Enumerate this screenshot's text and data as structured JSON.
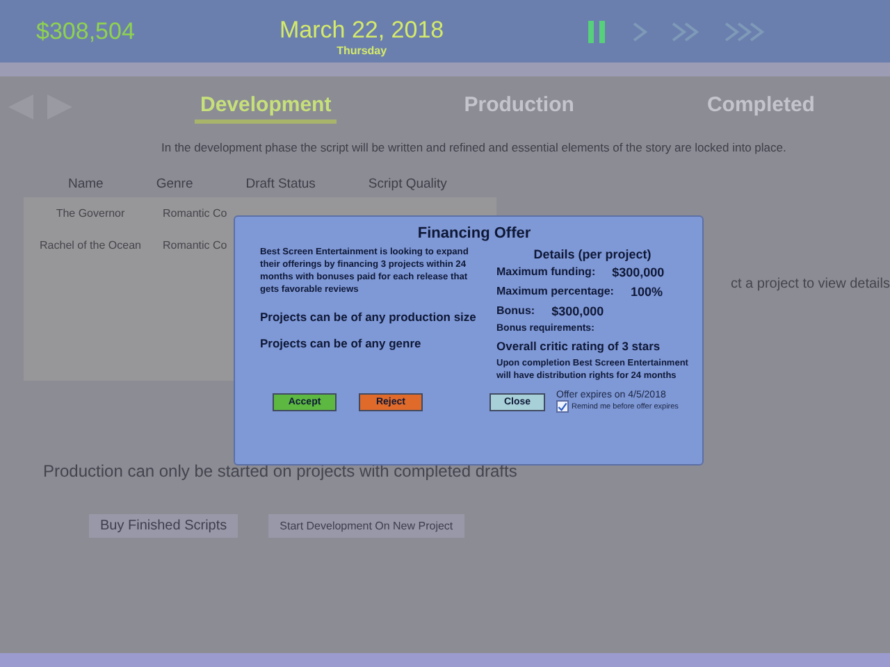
{
  "top_bar": {
    "money": "$308,504",
    "date": "March 22, 2018",
    "weekday": "Thursday",
    "speed_controls": [
      {
        "kind": "pause",
        "selected": true
      },
      {
        "kind": "play",
        "selected": false
      },
      {
        "kind": "fast",
        "selected": false
      },
      {
        "kind": "fastest",
        "selected": false
      }
    ]
  },
  "tabs": [
    {
      "label": "Development",
      "selected": true
    },
    {
      "label": "Production",
      "selected": false
    },
    {
      "label": "Completed",
      "selected": false
    }
  ],
  "description": "In the development phase the script will be written and refined and essential elements of the story are locked into place.",
  "table": {
    "columns": [
      "Name",
      "Genre",
      "Draft Status",
      "Script Quality"
    ],
    "rows": [
      {
        "name": "The Governor",
        "genre": "Romantic Co"
      },
      {
        "name": "Rachel of the Ocean",
        "genre": "Romantic Co"
      }
    ]
  },
  "details_hint": "ct a project to view details",
  "production_note": "Production can only be started on projects with completed drafts",
  "buttons": [
    "Buy Finished Scripts",
    "Start Development On New Project"
  ],
  "dialog": {
    "title": "Financing Offer",
    "intro": "Best Screen Entertainment is looking to expand their offerings by financing 3 projects within 24 months with bonuses paid for each release that gets favorable reviews",
    "conditions": [
      "Projects can be of any production size",
      "Projects can be of any genre"
    ],
    "details_title": "Details (per project)",
    "details": [
      {
        "label": "Maximum funding:",
        "value": "$300,000"
      },
      {
        "label": "Maximum percentage:",
        "value": "100%"
      },
      {
        "label": "Bonus:",
        "value": "$300,000"
      }
    ],
    "bonus_requirements_label": "Bonus requirements:",
    "bonus_requirement": "Overall critic rating of 3 stars",
    "distribution_note": "Upon completion Best Screen Entertainment will have distribution rights for 24 months",
    "accept": "Accept",
    "reject": "Reject",
    "close": "Close",
    "expiry": "Offer expires on 4/5/2018",
    "remind": {
      "label": "Remind me before offer expires",
      "checked": true
    }
  }
}
